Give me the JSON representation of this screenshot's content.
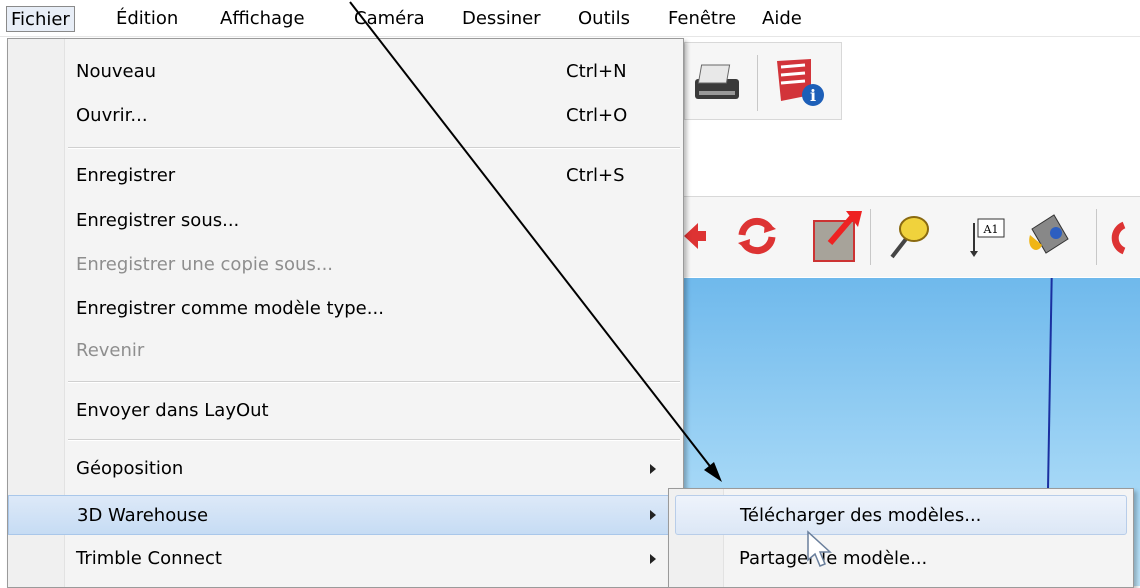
{
  "menubar": {
    "items": [
      {
        "label": "Fichier"
      },
      {
        "label": "Édition"
      },
      {
        "label": "Affichage"
      },
      {
        "label": "Caméra"
      },
      {
        "label": "Dessiner"
      },
      {
        "label": "Outils"
      },
      {
        "label": "Fenêtre"
      },
      {
        "label": "Aide"
      }
    ]
  },
  "file_menu": {
    "items": [
      {
        "label": "Nouveau",
        "shortcut": "Ctrl+N"
      },
      {
        "label": "Ouvrir...",
        "shortcut": "Ctrl+O"
      },
      {
        "label": "Enregistrer",
        "shortcut": "Ctrl+S"
      },
      {
        "label": "Enregistrer sous..."
      },
      {
        "label": "Enregistrer une copie sous...",
        "disabled": true
      },
      {
        "label": "Enregistrer comme modèle type..."
      },
      {
        "label": "Revenir",
        "disabled": true
      },
      {
        "label": "Envoyer dans LayOut"
      },
      {
        "label": "Géoposition",
        "submenu": true
      },
      {
        "label": "3D Warehouse",
        "submenu": true,
        "active": true
      },
      {
        "label": "Trimble Connect",
        "submenu": true
      }
    ]
  },
  "warehouse_submenu": {
    "items": [
      {
        "label": "Télécharger des modèles...",
        "hovered": true
      },
      {
        "label": "Partager le modèle..."
      }
    ]
  },
  "toolbar": {
    "text_tool_glyph": "A1",
    "icons": [
      "printer-icon",
      "model-info-icon",
      "move-icon",
      "rotate-icon",
      "push-pull-icon",
      "tape-measure-icon",
      "text-label-icon",
      "paint-bucket-icon"
    ]
  },
  "colors": {
    "menu_background": "#f4f4f4",
    "highlight": "#c6dcf4",
    "disabled_text": "#8e8e8e",
    "sky": "#8fd0f5",
    "axis_blue": "#1a2fa0"
  }
}
